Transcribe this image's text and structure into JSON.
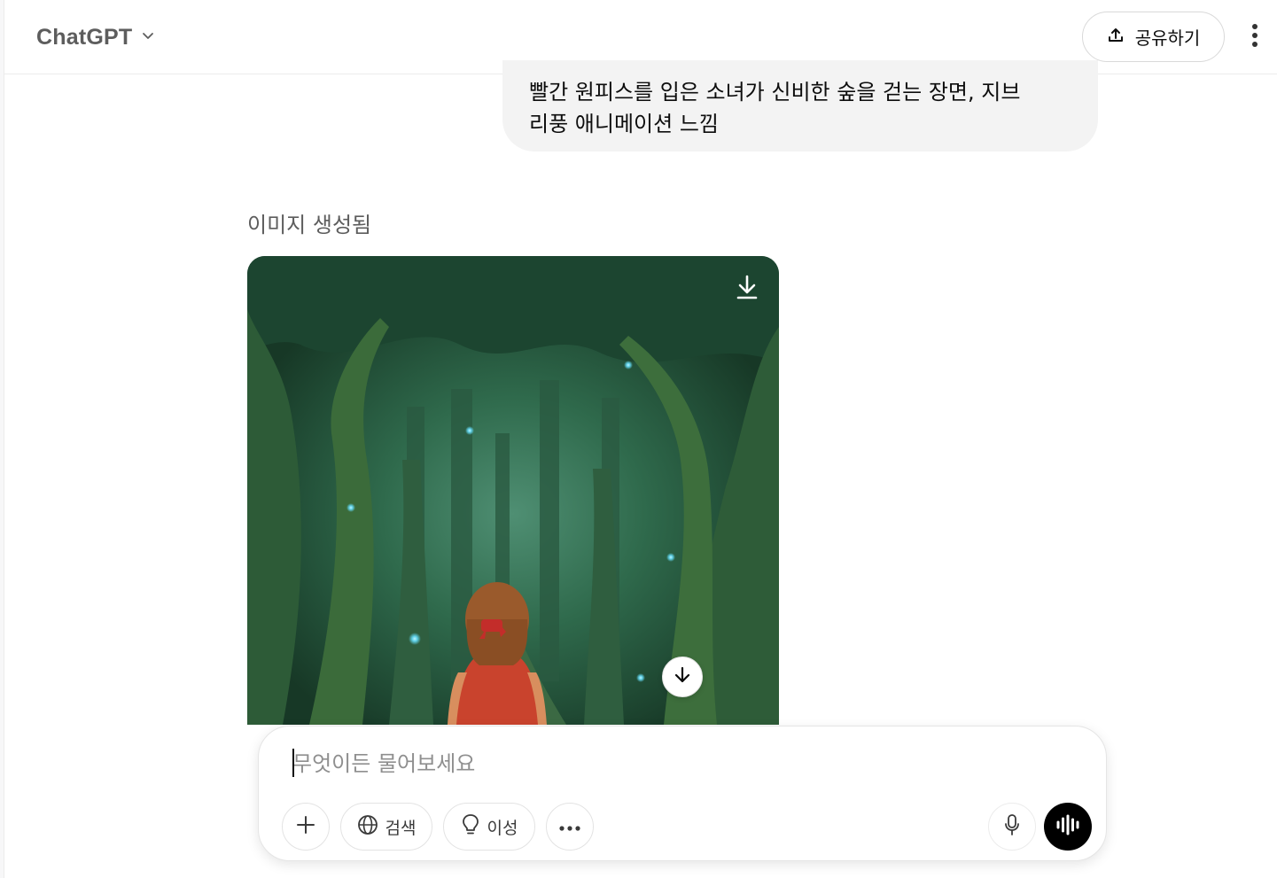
{
  "header": {
    "model_name": "ChatGPT",
    "share_label": "공유하기"
  },
  "conversation": {
    "user_message_line1": "빨간 원피스를 입은 소녀가 신비한 숲을 걷는 장면, 지브",
    "user_message_line2": "리풍 애니메이션 느낌",
    "generated_label": "이미지 생성됨"
  },
  "composer": {
    "placeholder": "무엇이든 물어보세요",
    "value": "",
    "tools": {
      "search_label": "검색",
      "reason_label": "이성"
    }
  },
  "icons": {
    "model_switch": "chevron-down-icon",
    "share": "upload-icon",
    "more": "vertical-dots-icon",
    "image_download": "download-icon",
    "scroll_down": "arrow-down-icon",
    "plus": "plus-icon",
    "search": "globe-icon",
    "reason": "lightbulb-icon",
    "more_tools": "horizontal-dots-icon",
    "mic": "microphone-icon",
    "voice": "voice-wave-icon"
  },
  "colors": {
    "bubble_bg": "#f3f3f3",
    "forest_dark": "#1f4a35",
    "forest_mid": "#2f6a4c",
    "dress_red": "#c9432d",
    "voice_button_bg": "#000000"
  }
}
